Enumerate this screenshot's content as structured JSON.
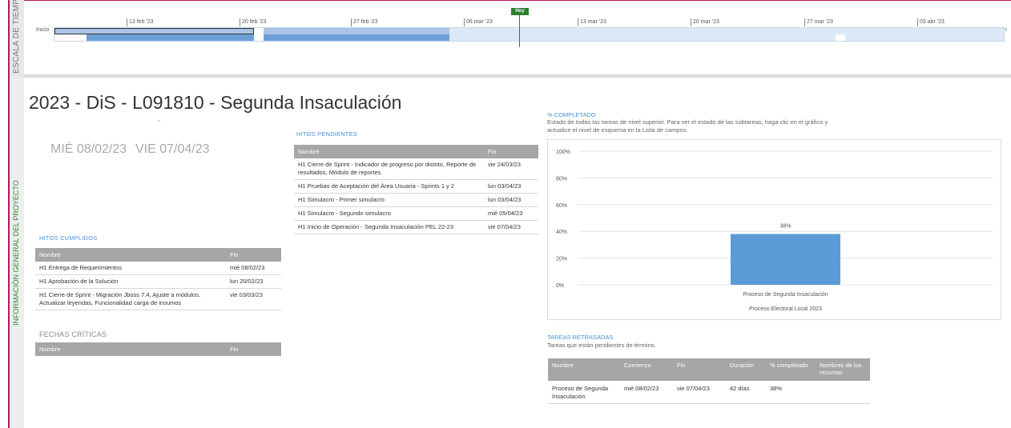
{
  "timeline": {
    "sidebar_label": "ESCALA DE TIEMPO",
    "today_label": "Hoy",
    "start_label": "Inicio",
    "end_label": "Fin",
    "dates": [
      "13 feb '23",
      "20 feb '23",
      "27 feb '23",
      "06 mar '23",
      "13 mar '23",
      "20 mar '23",
      "27 mar '23",
      "03 abr '23"
    ],
    "colors": {
      "bar_bg": "#dce8f5",
      "bar_fill": "#6d9fd6",
      "today": "#2e7d32"
    }
  },
  "sidebar": {
    "label": "INFORMACIÓN GENERAL DEL PROYECTO"
  },
  "project": {
    "title": "2023 - DiS - L091810 - Segunda Insaculación",
    "dash": "-",
    "start_date": "MIÉ 08/02/23",
    "end_date": "VIE 07/04/23"
  },
  "hitos_cumplidos": {
    "title": "HITOS CUMPLIDOS",
    "headers": [
      "Nombre",
      "Fin"
    ],
    "rows": [
      [
        "H1 Entrega de Requerimientos",
        "mié 08/02/23"
      ],
      [
        "H1 Aprobación de la Solución",
        "lun 20/02/23"
      ],
      [
        "H1 Cierre de Sprint - Migración Jboss 7.4, Ajuste a módulos, Actualizar leyendas, Funcionalidad carga de insumos",
        "vie 03/03/23"
      ]
    ]
  },
  "fechas_criticas": {
    "title": "FECHAS CRÍTICAS",
    "headers": [
      "Nombre",
      "Fin"
    ]
  },
  "hitos_pendientes": {
    "title": "HITOS PENDIENTES",
    "headers": [
      "Nombre",
      "Fin"
    ],
    "rows": [
      [
        "H1 Cierre de Sprint - Indicador de progreso por distrito, Reporte de resultados, Módulo de reportes",
        "vie 24/03/23"
      ],
      [
        "H1 Pruebas de Aceptación del Área Usuaria - Sprints 1 y 2",
        "lun 03/04/23"
      ],
      [
        "H1 Simulacro - Primer simulacro",
        "lun 03/04/23"
      ],
      [
        "H1 Simulacro - Segundo simulacro",
        "mié 05/04/23"
      ],
      [
        "H1 Inicio de Operación - Segunda Insaculación PEL 22-23",
        "vie 07/04/23"
      ]
    ]
  },
  "completado": {
    "title": "% COMPLETADO",
    "description": "Estado de todas las tareas de nivel superior. Para ver el estado de las subtareas, haga clic en el gráfico y actualice el nivel de esquema en la Lista de campos."
  },
  "chart_data": {
    "type": "bar",
    "categories": [
      "Proceso de Segunda Insaculación"
    ],
    "values": [
      38
    ],
    "data_labels": [
      "38%"
    ],
    "yticks": [
      "0%",
      "20%",
      "40%",
      "60%",
      "80%",
      "100%"
    ],
    "ylim": [
      0,
      100
    ],
    "xlabel": "Proceso Electoral Local 2023",
    "grid": true,
    "bar_color": "#5b9bd5"
  },
  "tareas_retrasadas": {
    "title": "TAREAS RETRASADAS",
    "description": "Tareas que están pendientes de término.",
    "headers": [
      "Nombre",
      "Comienzo",
      "Fin",
      "Duración",
      "% completado",
      "Nombres de los recursos"
    ],
    "rows": [
      [
        "Proceso de Segunda Insaculación",
        "mié 08/02/23",
        "vie 07/04/23",
        "42 días",
        "38%",
        ""
      ]
    ]
  }
}
